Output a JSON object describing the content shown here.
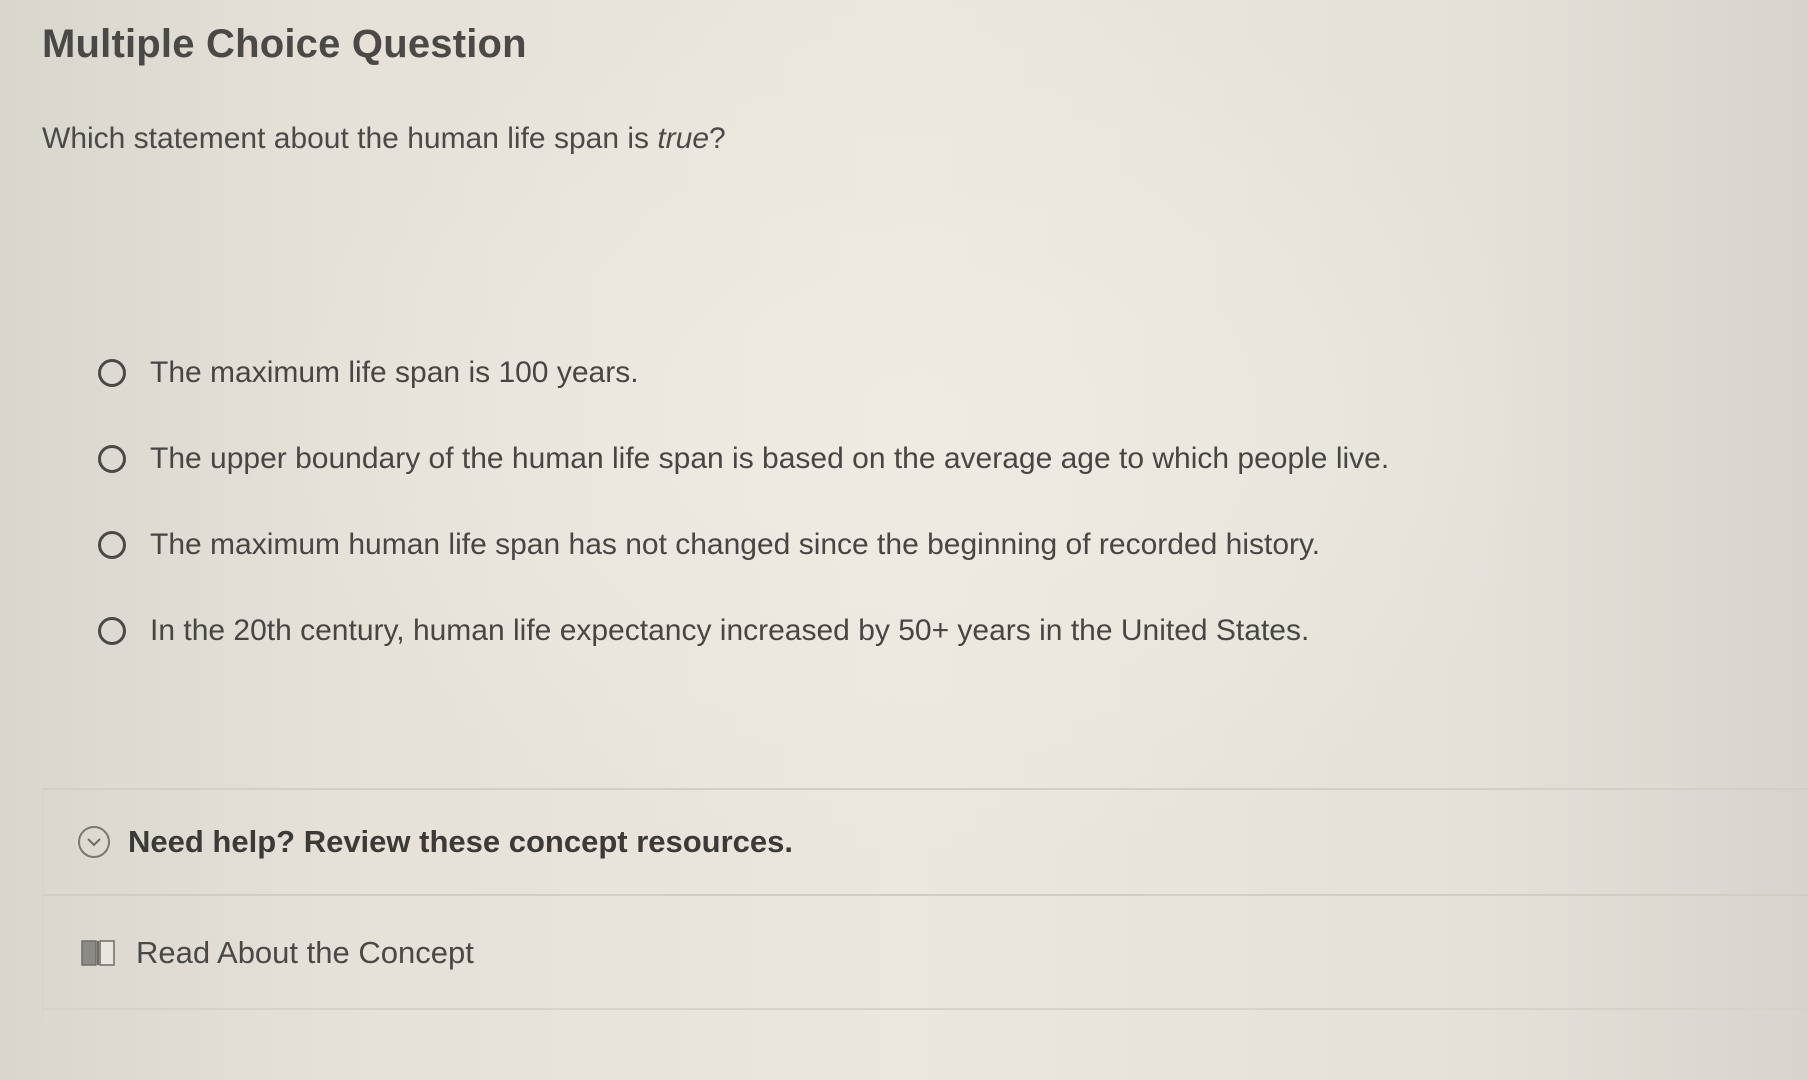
{
  "header": {
    "title": "Multiple Choice Question"
  },
  "question": {
    "prompt_before": "Which statement about the human life span is ",
    "prompt_emphasis": "true",
    "prompt_after": "?"
  },
  "options": [
    {
      "label": "The maximum life span is 100 years."
    },
    {
      "label": "The upper boundary of the human life span is based on the average age to which people live."
    },
    {
      "label": "The maximum human life span has not changed since the beginning of recorded history."
    },
    {
      "label": "In the 20th century, human life expectancy increased by 50+ years in the United States."
    }
  ],
  "help": {
    "title": "Need help? Review these concept resources.",
    "icon": "chevron-down-circle-icon",
    "resources": [
      {
        "label": "Read About the Concept",
        "icon": "book-icon"
      }
    ]
  }
}
